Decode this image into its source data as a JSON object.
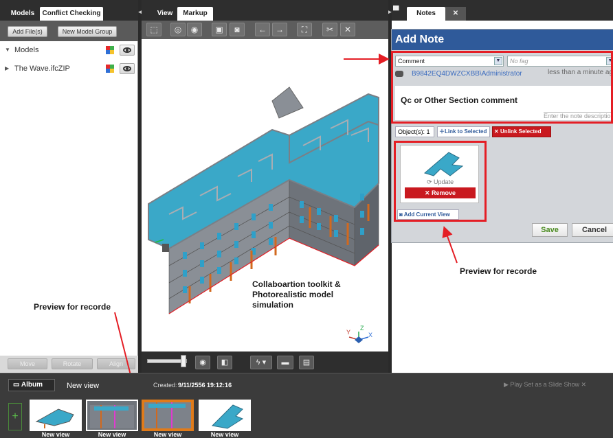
{
  "left_panel": {
    "tabs": [
      "Models",
      "Conflict Checking"
    ],
    "buttons": [
      "Add File(s)",
      "New Model Group"
    ],
    "tree": [
      {
        "label": "Models",
        "expanded": true
      },
      {
        "label": "The Wave.ifcZIP",
        "expanded": false
      }
    ],
    "bottom_buttons": [
      "Move",
      "Rotate",
      "Align"
    ]
  },
  "center_panel": {
    "tabs": [
      "View",
      "Markup"
    ],
    "toolbar_icons": [
      "select-box-icon",
      "orbit-icon",
      "orbit-select-icon",
      "camera-icon",
      "camera-eye-icon",
      "undo-icon",
      "redo-icon",
      "fit-icon",
      "cut-icon",
      "cut-off-icon"
    ],
    "annotation": "Collaboartion toolkit &\nPhotorealistic model\nsimulation",
    "axis_labels": [
      "Y",
      "Z",
      "X"
    ],
    "bottom_icons": [
      "eye-icon",
      "box-icon",
      "lightning-icon",
      "comment-icon",
      "page-icon"
    ]
  },
  "right_panel": {
    "tabs": [
      "Notes"
    ],
    "dialog": {
      "title": "Add Note",
      "type_value": "Comment",
      "tag_placeholder": "No fag",
      "author": "B9842EQ4DWZCXBB\\Administrator",
      "time": "less than a minute ag",
      "comment": "Qc or Other Section comment",
      "description_placeholder": "Enter the note description",
      "objects_label": "Object(s):",
      "objects_count": "1",
      "link_label": "Link to Selected",
      "unlink_label": "Unlink Selected",
      "update_label": "Update",
      "remove_label": "Remove",
      "add_view_label": "Add Current View",
      "save_label": "Save",
      "cancel_label": "Cancel"
    },
    "annotation": "Preview for recorde"
  },
  "album": {
    "button": "Album",
    "view_title": "New view",
    "created_label": "Created:",
    "created_value": "9/11/2556 19:12:16",
    "slideshow": "Play Set as a Slide Show",
    "annotation": "Preview for recorde",
    "thumbnails": [
      "New view",
      "New view",
      "New view",
      "New view"
    ]
  },
  "colors": {
    "highlight_red": "#e41e25",
    "header_blue": "#2f5a9a",
    "model_cyan": "#3aa8c8",
    "selected_thumb": "#e07b1a"
  }
}
